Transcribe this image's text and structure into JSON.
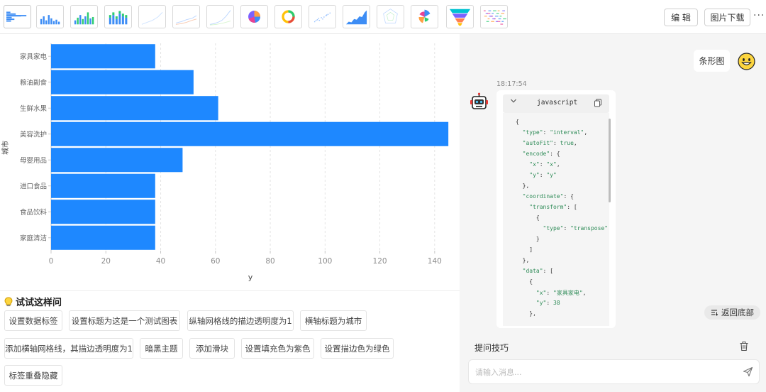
{
  "toolbar": {
    "chart_types": [
      "bar-horizontal-icon",
      "column-icon",
      "column-grouped-icon",
      "column-stacked-icon",
      "line-icon",
      "line-multi-icon",
      "line-stepped-icon",
      "pie-icon",
      "donut-icon",
      "scatter-icon",
      "area-icon",
      "radar-icon",
      "rose-icon",
      "funnel-icon",
      "wordcloud-icon"
    ],
    "edit_label": "编 辑",
    "download_label": "图片下载",
    "more_label": "···"
  },
  "chart_data": {
    "type": "bar",
    "orientation": "horizontal",
    "categories": [
      "家具家电",
      "粮油副食",
      "生鲜水果",
      "美容洗护",
      "母婴用品",
      "进口食品",
      "食品饮料",
      "家庭清洁"
    ],
    "values": [
      38,
      52,
      61,
      145,
      48,
      38,
      38,
      38
    ],
    "xlabel": "y",
    "ylabel": "城市",
    "xlim": [
      0,
      146
    ],
    "xticks": [
      0,
      20,
      40,
      60,
      80,
      100,
      120,
      140
    ],
    "grid": "vertical dashed",
    "color": "#1E88FF"
  },
  "suggestions": {
    "title": "试试这样问",
    "chips": [
      "设置数据标签",
      "设置标题为这是一个测试图表",
      "纵轴网格线的描边透明度为1",
      "横轴标题为城市",
      "添加横轴网格线，其描边透明度为1",
      "暗黑主题",
      "添加滑块",
      "设置填充色为紫色",
      "设置描边色为绿色",
      "标签重叠隐藏"
    ]
  },
  "chat": {
    "user_message": "条形图",
    "timestamp": "18:17:54",
    "code_lang": "javascript",
    "code_lines": [
      "{",
      "  \"type\": \"interval\",",
      "  \"autoFit\": true,",
      "  \"encode\": {",
      "    \"x\": \"x\",",
      "    \"y\": \"y\"",
      "  },",
      "  \"coordinate\": {",
      "    \"transform\": [",
      "      {",
      "        \"type\": \"transpose\"",
      "      }",
      "    ]",
      "  },",
      "  \"data\": [",
      "    {",
      "      \"x\": \"家具家电\",",
      "      \"y\": 38",
      "    },"
    ],
    "back_to_bottom": "返回底部",
    "tips_label": "提问技巧",
    "input_placeholder": "请输入消息..."
  }
}
